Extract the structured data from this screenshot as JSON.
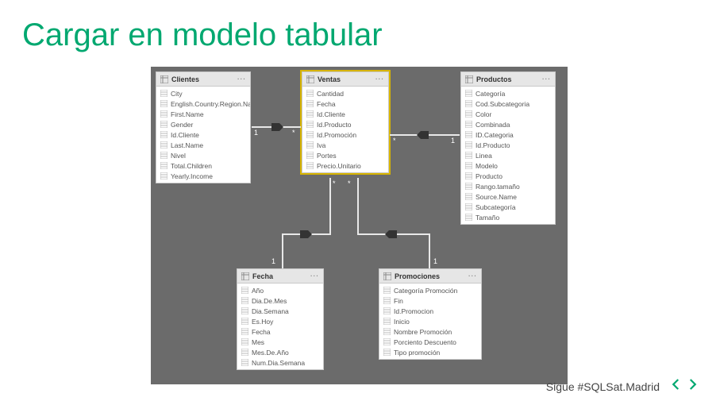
{
  "title": "Cargar en modelo tabular",
  "footer": {
    "text": "Sigue #SQLSat.Madrid"
  },
  "tables": {
    "clientes": {
      "name": "Clientes",
      "fields": [
        "City",
        "English.Country.Region.Na...",
        "First.Name",
        "Gender",
        "Id.Cliente",
        "Last.Name",
        "Nivel",
        "Total.Children",
        "Yearly.Income"
      ]
    },
    "ventas": {
      "name": "Ventas",
      "fields": [
        "Cantidad",
        "Fecha",
        "Id.Cliente",
        "Id.Producto",
        "Id.Promoción",
        "Iva",
        "Portes",
        "Precio.Unitario"
      ]
    },
    "productos": {
      "name": "Productos",
      "fields": [
        "Categoría",
        "Cod.Subcategoria",
        "Color",
        "Combinada",
        "ID.Categoria",
        "Id.Producto",
        "Linea",
        "Modelo",
        "Producto",
        "Rango.tamaño",
        "Source.Name",
        "Subcategoría",
        "Tamaño"
      ]
    },
    "fecha": {
      "name": "Fecha",
      "fields": [
        "Año",
        "Dia.De.Mes",
        "Dia.Semana",
        "Es.Hoy",
        "Fecha",
        "Mes",
        "Mes.De.Año",
        "Num.Dia.Semana"
      ]
    },
    "promociones": {
      "name": "Promociones",
      "fields": [
        "Categoría Promoción",
        "Fin",
        "Id.Promocion",
        "Inicio",
        "Nombre Promoción",
        "Porciento Descuento",
        "Tipo promoción"
      ]
    }
  },
  "relationships": [
    {
      "from": "clientes",
      "to": "ventas",
      "card_from": "1",
      "card_to": "*"
    },
    {
      "from": "productos",
      "to": "ventas",
      "card_from": "1",
      "card_to": "*"
    },
    {
      "from": "fecha",
      "to": "ventas",
      "card_from": "1",
      "card_to": "*"
    },
    {
      "from": "promociones",
      "to": "ventas",
      "card_from": "1",
      "card_to": "*"
    }
  ]
}
